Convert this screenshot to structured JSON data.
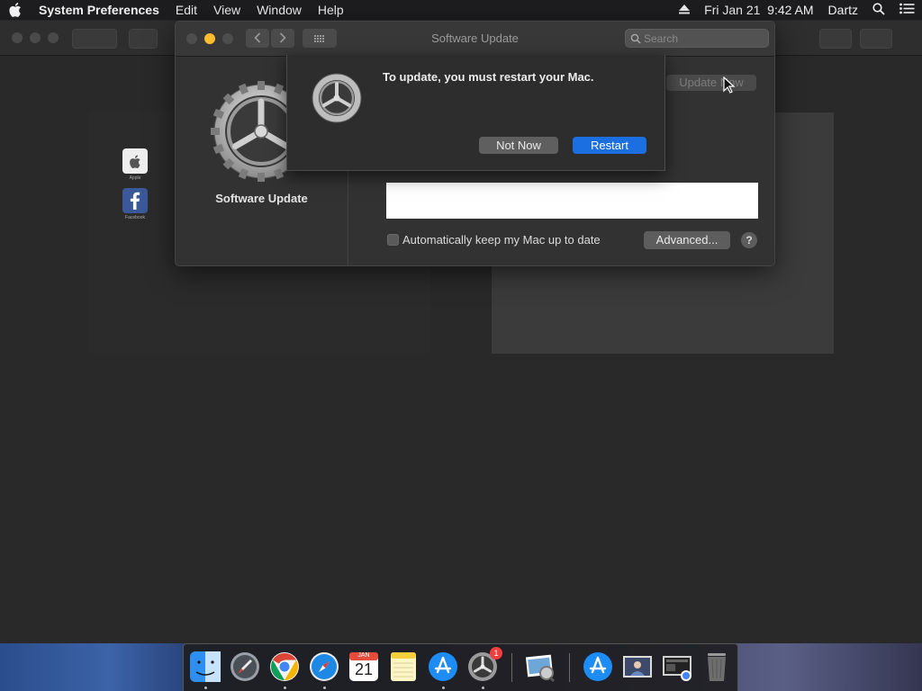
{
  "menubar": {
    "app": "System Preferences",
    "items": [
      "Edit",
      "View",
      "Window",
      "Help"
    ],
    "datetime": "Fri Jan 21  9:42 AM",
    "user": "Dartz"
  },
  "background_window": {
    "icons": [
      {
        "name": "apple-bookmark-icon",
        "caption": "Apple"
      },
      {
        "name": "facebook-bookmark-icon",
        "caption": "Facebook"
      }
    ]
  },
  "prefs_window": {
    "title": "Software Update",
    "search_placeholder": "Search",
    "sidebar_label": "Software Update",
    "update_now_label": "Update Now",
    "auto_update_label": "Automatically keep my Mac up to date",
    "advanced_label": "Advanced...",
    "help_label": "?"
  },
  "sheet": {
    "message": "To update, you must restart your Mac.",
    "not_now_label": "Not Now",
    "restart_label": "Restart"
  },
  "dock": {
    "calendar_month": "JAN",
    "calendar_day": "21",
    "prefs_badge": "1",
    "items": [
      "finder",
      "launchpad",
      "chrome",
      "safari",
      "calendar",
      "notes",
      "app-store",
      "system-preferences",
      "preview",
      "app-store-2",
      "photo",
      "screenshot",
      "trash"
    ]
  },
  "colors": {
    "accent": "#1c6fe0",
    "close": "#ff5f57",
    "minimize": "#febc2e"
  }
}
